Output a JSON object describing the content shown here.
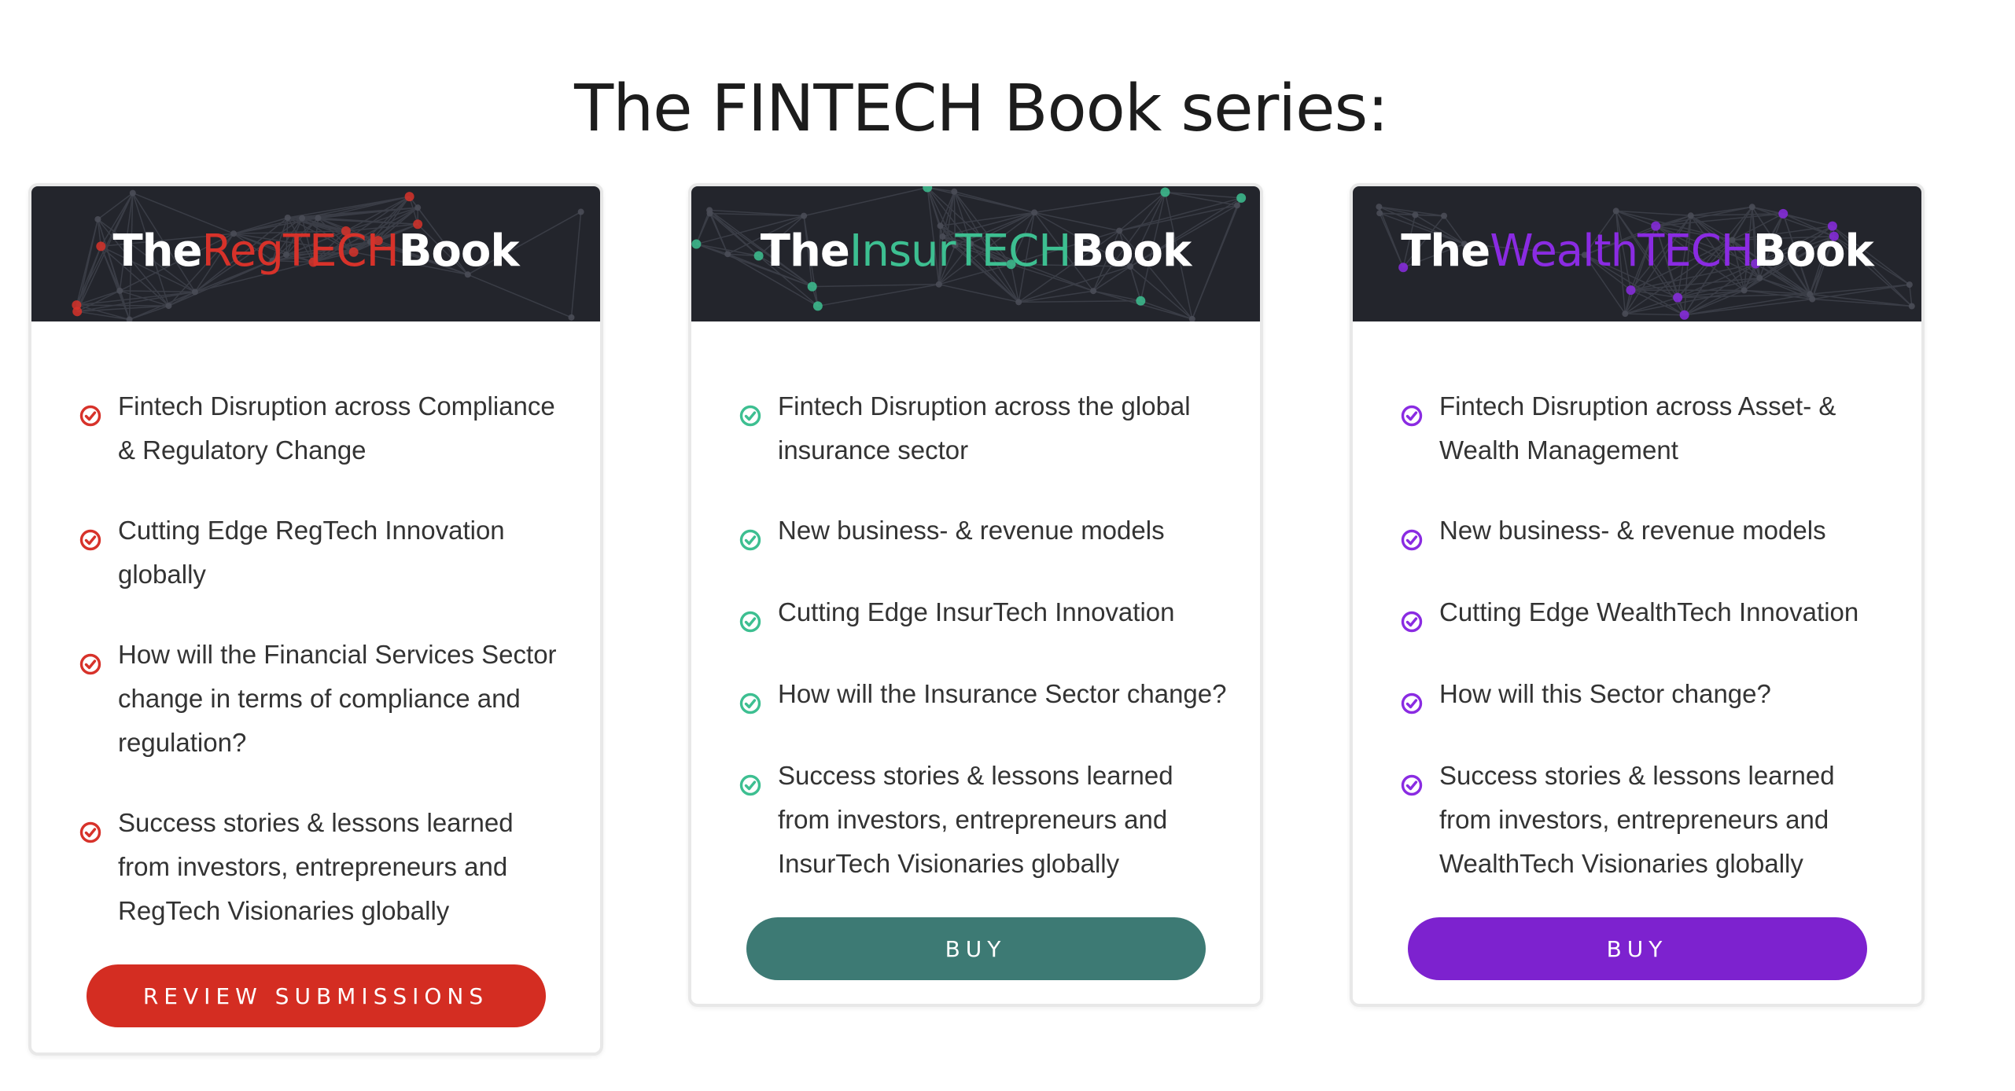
{
  "page": {
    "title": "The FINTECH Book series:"
  },
  "cards": [
    {
      "banner": {
        "prefix": "The",
        "accent": "RegTECH",
        "suffix": "Book",
        "accent_color": "#d7322a"
      },
      "check_color": "#d7322a",
      "features": [
        "Fintech Disruption across Compliance & Regulatory Change",
        "Cutting Edge RegTech Innovation globally",
        "How will the Financial Services Sector change in terms of compliance and regulation?",
        "Success stories & lessons learned from investors, entrepreneurs and RegTech Visionaries globally"
      ],
      "button": {
        "label": "REVIEW SUBMISSIONS",
        "color": "#d42d22"
      }
    },
    {
      "banner": {
        "prefix": "The",
        "accent": "InsurTECH",
        "suffix": "Book",
        "accent_color": "#3dbf91"
      },
      "check_color": "#3dbf91",
      "features": [
        "Fintech Disruption across the global insurance sector",
        "New business- & revenue models",
        "Cutting Edge InsurTech Innovation",
        "How will the Insurance Sector change?",
        "Success stories & lessons learned from investors, entrepreneurs and InsurTech Visionaries globally"
      ],
      "button": {
        "label": "BUY",
        "color": "#3d7a74"
      }
    },
    {
      "banner": {
        "prefix": "The",
        "accent": "WealthTECH",
        "suffix": "Book",
        "accent_color": "#8a2be2"
      },
      "check_color": "#8a2be2",
      "features": [
        "Fintech Disruption across Asset- & Wealth Management",
        "New business- & revenue models",
        "Cutting Edge WealthTech Innovation",
        "How will this Sector change?",
        "Success stories & lessons learned from investors, entrepreneurs and WealthTech Visionaries globally"
      ],
      "button": {
        "label": "BUY",
        "color": "#7d22cf"
      }
    }
  ]
}
